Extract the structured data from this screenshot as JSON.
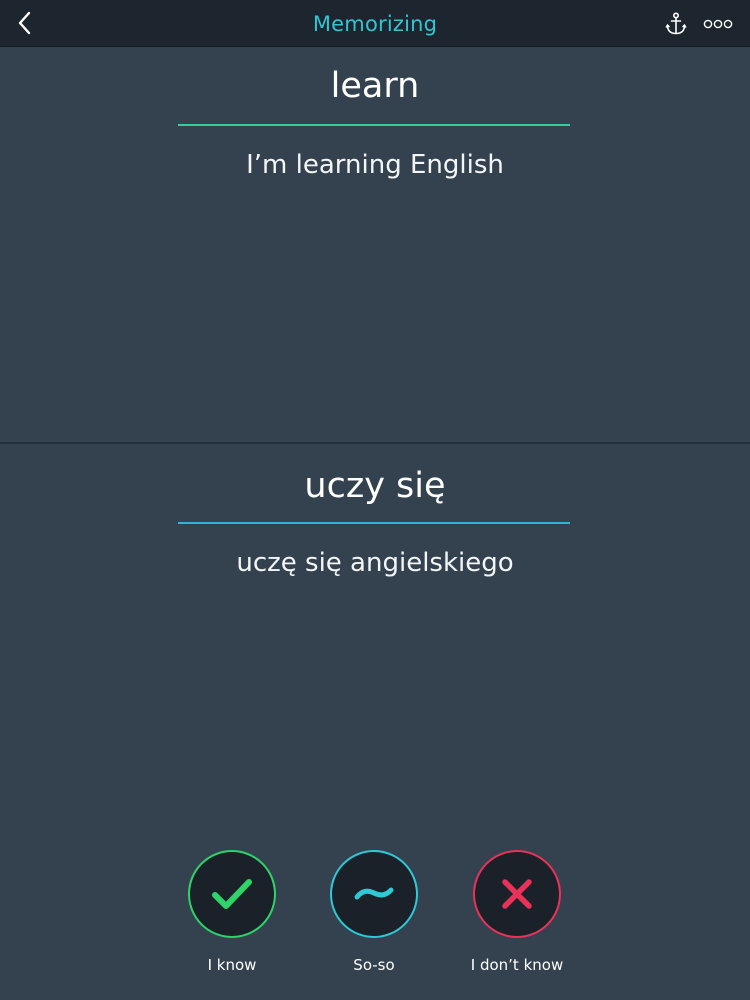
{
  "header": {
    "title": "Memorizing",
    "back_icon": "chevron-left-icon",
    "anchor_icon": "anchor-icon",
    "more_icon": "more-dots-icon"
  },
  "card": {
    "front": {
      "word": "learn",
      "example": "I’m learning English"
    },
    "back": {
      "word": "uczy się",
      "example": "uczę się angielskiego"
    }
  },
  "answers": [
    {
      "label": "I know",
      "icon": "check-icon",
      "color": "#2fd36a"
    },
    {
      "label": "So-so",
      "icon": "tilde-icon",
      "color": "#2fc8d6"
    },
    {
      "label": "I don’t know",
      "icon": "cross-icon",
      "color": "#e8325a"
    }
  ],
  "colors": {
    "background": "#34424f",
    "header": "#1d262e",
    "accent": "#32c4d3",
    "front_underline": "#2fd39a",
    "back_underline": "#34b3d6"
  }
}
